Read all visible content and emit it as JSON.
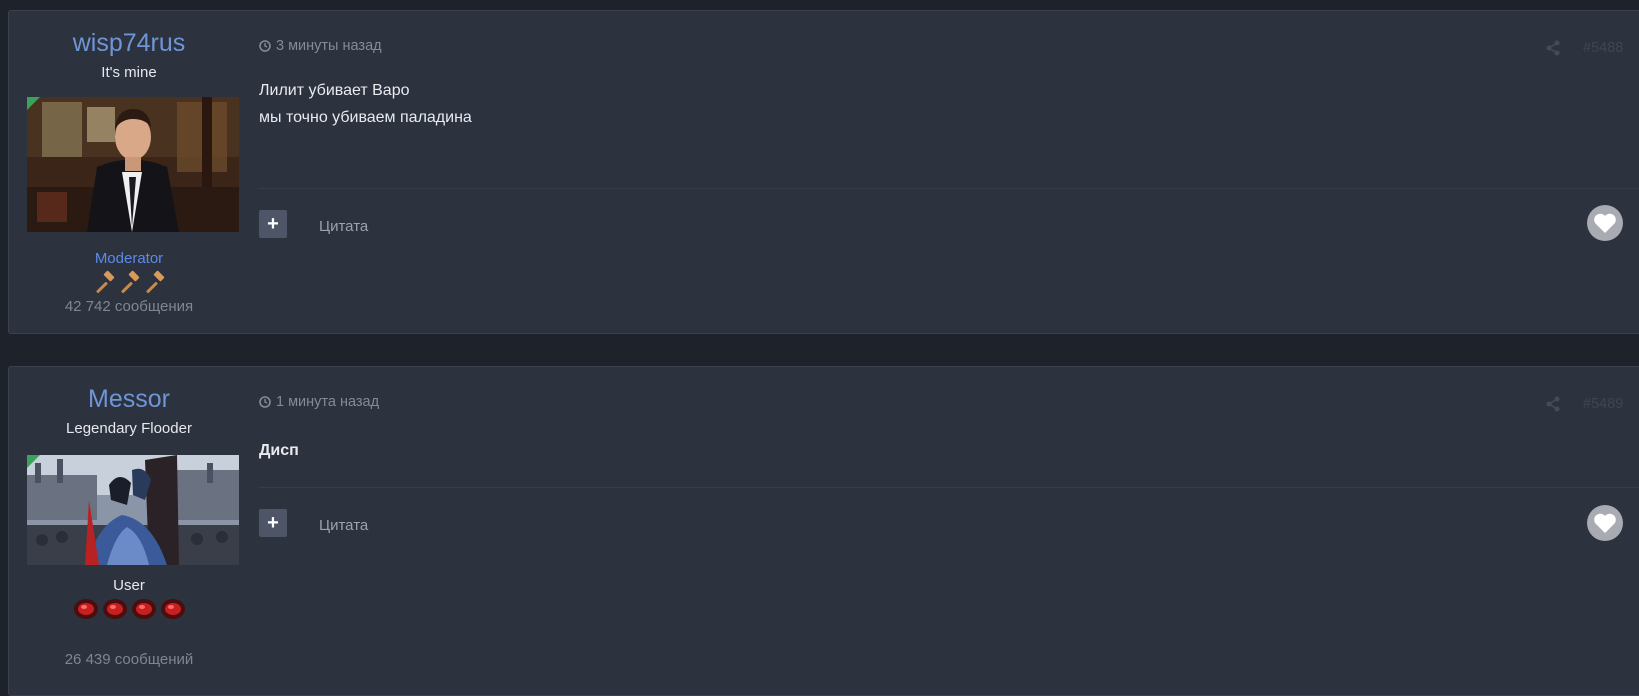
{
  "posts": [
    {
      "author": {
        "username": "wisp74rus",
        "title": "It's mine",
        "avatar_alt": "avatar",
        "group": "Moderator",
        "group_color": "#5b8be8",
        "rank_icon": "gavel-icon",
        "rank_count": 3,
        "post_count": "42 742 сообщения"
      },
      "time": "3 минуты назад",
      "number": "#5488",
      "content": [
        "Лилит убивает Варо",
        "мы точно убиваем паладина"
      ],
      "bold": false,
      "quote_label": "Цитата"
    },
    {
      "author": {
        "username": "Messor",
        "title": "Legendary Flooder",
        "avatar_alt": "avatar",
        "group": "User",
        "group_color": "#e6e8ec",
        "rank_icon": "red-gem-icon",
        "rank_count": 4,
        "post_count": "26 439 сообщений"
      },
      "time": "1 минута назад",
      "number": "#5489",
      "content": [
        "Дисп"
      ],
      "bold": true,
      "quote_label": "Цитата"
    }
  ],
  "colors": {
    "background": "#1e222b",
    "post_background": "#2d323f",
    "username": "#6e96d6",
    "online": "#3aa35a"
  }
}
